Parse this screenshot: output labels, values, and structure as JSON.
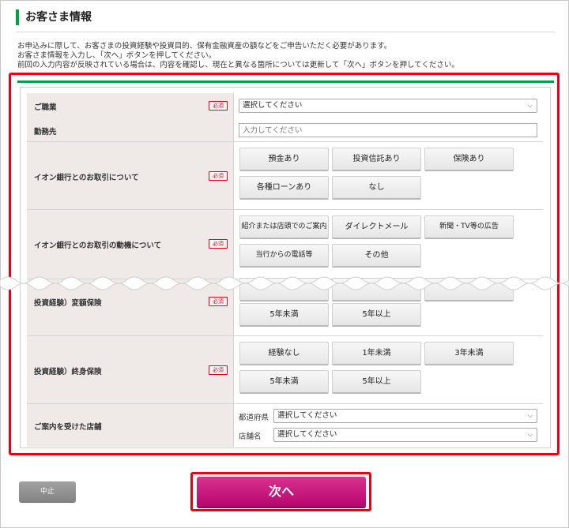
{
  "page": {
    "title": "お客さま情報",
    "intro": [
      "お申込みに際して、お客さまの投資経験や投資目的、保有金融資産の額などをご申告いただく必要があります。",
      "お客さま情報を入力し、「次へ」ボタンを押してください。",
      "前回の入力内容が反映されている場合は、内容を確認し、現在と異なる箇所については更新して「次へ」ボタンを押してください。"
    ]
  },
  "required_label": "必須",
  "form": {
    "occupation": {
      "label": "ご職業",
      "select_value": "選択してください"
    },
    "workplace": {
      "label": "勤務先",
      "placeholder": "入力してください"
    },
    "relationship": {
      "label": "イオン銀行とのお取引について",
      "options": [
        "預金あり",
        "投資信託あり",
        "保険あり",
        "各種ローンあり",
        "なし"
      ]
    },
    "motive": {
      "label": "イオン銀行とのお取引の動機について",
      "options": [
        "紹介または店頭でのご案内",
        "ダイレクトメール",
        "新聞・TV等の広告",
        "当行からの電話等",
        "その他"
      ]
    },
    "variable_insurance": {
      "label": "投資経験）変額保険",
      "options": [
        "5年未満",
        "5年以上"
      ]
    },
    "whole_life_insurance": {
      "label": "投資経験）終身保険",
      "options": [
        "経験なし",
        "1年未満",
        "3年未満",
        "5年未満",
        "5年以上"
      ]
    },
    "branch": {
      "label": "ご案内を受けた店舗",
      "prefecture_label": "都道府県",
      "prefecture_value": "選択してください",
      "store_label": "店舗名",
      "store_value": "選択してください"
    }
  },
  "buttons": {
    "cancel": "中止",
    "next": "次へ"
  },
  "icons": {
    "select_chevron": "chevron-down-icon"
  },
  "colors": {
    "accent_green": "#00a04a",
    "highlight_red": "#e60012",
    "next_magenta": "#c4117c"
  }
}
